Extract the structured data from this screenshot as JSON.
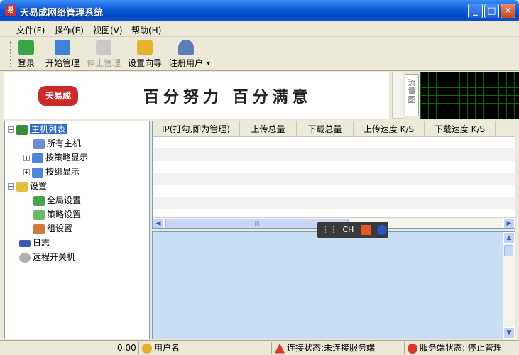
{
  "window": {
    "title": "天易成网络管理系统",
    "minimize": "_",
    "maximize": "□",
    "close": "✕"
  },
  "menu": [
    "文件(F)",
    "操作(E)",
    "视图(V)",
    "帮助(H)"
  ],
  "toolbar": {
    "login": "登录",
    "start": "开始管理",
    "stop": "停止管理",
    "wizard": "设置向导",
    "register": "注册用户",
    "dropdown": "▾"
  },
  "banner": {
    "logo": "天易成",
    "slogan": "百分努力 百分满意",
    "flow_label": "流量图"
  },
  "tree": {
    "host_list": "主机列表",
    "all_hosts": "所有主机",
    "by_policy": "按策略显示",
    "by_group": "按组显示",
    "settings": "设置",
    "global_settings": "全局设置",
    "policy_settings": "策略设置",
    "group_settings": "组设置",
    "log": "日志",
    "remote_power": "远程开关机"
  },
  "grid": {
    "columns": [
      "IP(打勾,即为管理)",
      "上传总量",
      "下载总量",
      "上传速度 K/S",
      "下载速度 K/S"
    ],
    "thumb_grip": "|||"
  },
  "ime": {
    "label": "CH"
  },
  "status": {
    "value": "0.00",
    "username": "用户名",
    "connection": "连接状态:未连接服务端",
    "server": "服务端状态: 停止管理"
  },
  "colors": {
    "titlebar": "#0a5bd8",
    "selection": "#316ac5",
    "log_bg": "#c9ddf5",
    "graph_grid": "#0a6a0a"
  }
}
